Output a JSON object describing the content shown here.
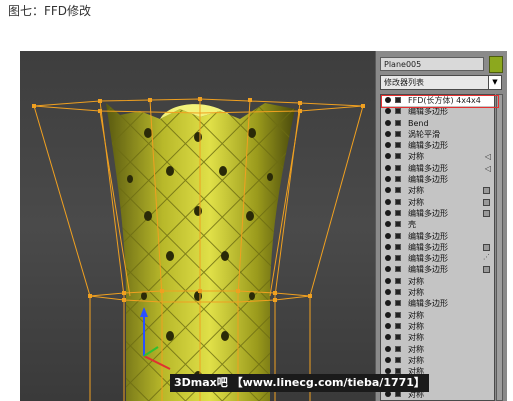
{
  "caption": "图七：FFD修改",
  "panel": {
    "object_name": "Plane005",
    "object_color": "#8ca81e",
    "modifier_list": "修改器列表",
    "dropdown_arrow": "▼",
    "stack": [
      {
        "label": "FFD(长方体) 4x4x4",
        "selected": true,
        "icon": "none"
      },
      {
        "label": "编辑多边形",
        "icon": "none"
      },
      {
        "label": "Bend",
        "icon": "none"
      },
      {
        "label": "涡轮平滑",
        "icon": "none"
      },
      {
        "label": "编辑多边形",
        "icon": "none"
      },
      {
        "label": "对称",
        "icon": "tri"
      },
      {
        "label": "编辑多边形",
        "icon": "tri"
      },
      {
        "label": "编辑多边形",
        "icon": "none"
      },
      {
        "label": "对称",
        "icon": "box"
      },
      {
        "label": "对称",
        "icon": "box"
      },
      {
        "label": "编辑多边形",
        "icon": "box"
      },
      {
        "label": "壳",
        "icon": "none"
      },
      {
        "label": "编辑多边形",
        "icon": "none"
      },
      {
        "label": "编辑多边形",
        "icon": "box"
      },
      {
        "label": "编辑多边形",
        "icon": "dots"
      },
      {
        "label": "编辑多边形",
        "icon": "box"
      },
      {
        "label": "对称",
        "icon": "none"
      },
      {
        "label": "对称",
        "icon": "none"
      },
      {
        "label": "编辑多边形",
        "icon": "none"
      },
      {
        "label": "对称",
        "icon": "none"
      },
      {
        "label": "对称",
        "icon": "none"
      },
      {
        "label": "对称",
        "icon": "none"
      },
      {
        "label": "对称",
        "icon": "none"
      },
      {
        "label": "对称",
        "icon": "none"
      },
      {
        "label": "对称",
        "icon": "none"
      },
      {
        "label": "对称",
        "icon": "none"
      },
      {
        "label": "对称",
        "icon": "none"
      }
    ]
  },
  "viewport": {
    "object_color": "#c8c832",
    "lattice_color": "#f0a020"
  },
  "watermark": "3Dmax吧 【www.linecg.com/tieba/1771】"
}
